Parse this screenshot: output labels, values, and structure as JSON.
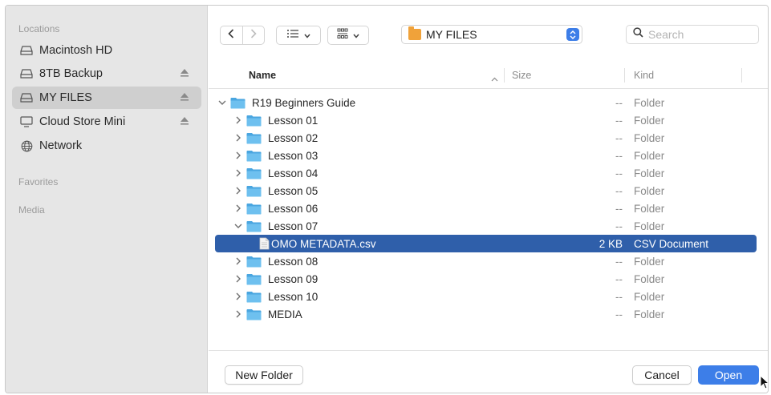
{
  "sidebar": {
    "sections": {
      "locations": "Locations",
      "favorites": "Favorites",
      "media": "Media"
    },
    "items": [
      {
        "label": "Macintosh HD",
        "icon": "drive-icon",
        "eject": false,
        "selected": false
      },
      {
        "label": "8TB Backup",
        "icon": "drive-icon",
        "eject": true,
        "selected": false
      },
      {
        "label": "MY FILES",
        "icon": "drive-icon",
        "eject": true,
        "selected": true
      },
      {
        "label": "Cloud Store Mini",
        "icon": "monitor-icon",
        "eject": true,
        "selected": false
      },
      {
        "label": "Network",
        "icon": "globe-icon",
        "eject": false,
        "selected": false
      }
    ]
  },
  "toolbar": {
    "back_icon": "chevron-left-icon",
    "forward_icon": "chevron-right-icon",
    "list_view_icon": "list-view-icon",
    "group_icon": "grid-group-icon",
    "path": "MY FILES",
    "search_placeholder": "Search",
    "accent": "#3d7ee8"
  },
  "columns": {
    "name": "Name",
    "size": "Size",
    "kind": "Kind"
  },
  "files": [
    {
      "name": "R19 Beginners Guide",
      "level": 0,
      "expanded": true,
      "type": "folder",
      "size": "--",
      "kind": "Folder"
    },
    {
      "name": "Lesson 01",
      "level": 1,
      "expanded": false,
      "type": "folder",
      "size": "--",
      "kind": "Folder"
    },
    {
      "name": "Lesson 02",
      "level": 1,
      "expanded": false,
      "type": "folder",
      "size": "--",
      "kind": "Folder"
    },
    {
      "name": "Lesson 03",
      "level": 1,
      "expanded": false,
      "type": "folder",
      "size": "--",
      "kind": "Folder"
    },
    {
      "name": "Lesson 04",
      "level": 1,
      "expanded": false,
      "type": "folder",
      "size": "--",
      "kind": "Folder"
    },
    {
      "name": "Lesson 05",
      "level": 1,
      "expanded": false,
      "type": "folder",
      "size": "--",
      "kind": "Folder"
    },
    {
      "name": "Lesson 06",
      "level": 1,
      "expanded": false,
      "type": "folder",
      "size": "--",
      "kind": "Folder"
    },
    {
      "name": "Lesson 07",
      "level": 1,
      "expanded": true,
      "type": "folder",
      "size": "--",
      "kind": "Folder"
    },
    {
      "name": "OMO METADATA.csv",
      "level": 2,
      "expanded": false,
      "type": "file",
      "size": "2 KB",
      "kind": "CSV Document",
      "selected": true
    },
    {
      "name": "Lesson 08",
      "level": 1,
      "expanded": false,
      "type": "folder",
      "size": "--",
      "kind": "Folder"
    },
    {
      "name": "Lesson 09",
      "level": 1,
      "expanded": false,
      "type": "folder",
      "size": "--",
      "kind": "Folder"
    },
    {
      "name": "Lesson 10",
      "level": 1,
      "expanded": false,
      "type": "folder",
      "size": "--",
      "kind": "Folder"
    },
    {
      "name": "MEDIA",
      "level": 1,
      "expanded": false,
      "type": "folder",
      "size": "--",
      "kind": "Folder"
    }
  ],
  "footer": {
    "new_folder": "New Folder",
    "cancel": "Cancel",
    "open": "Open"
  }
}
